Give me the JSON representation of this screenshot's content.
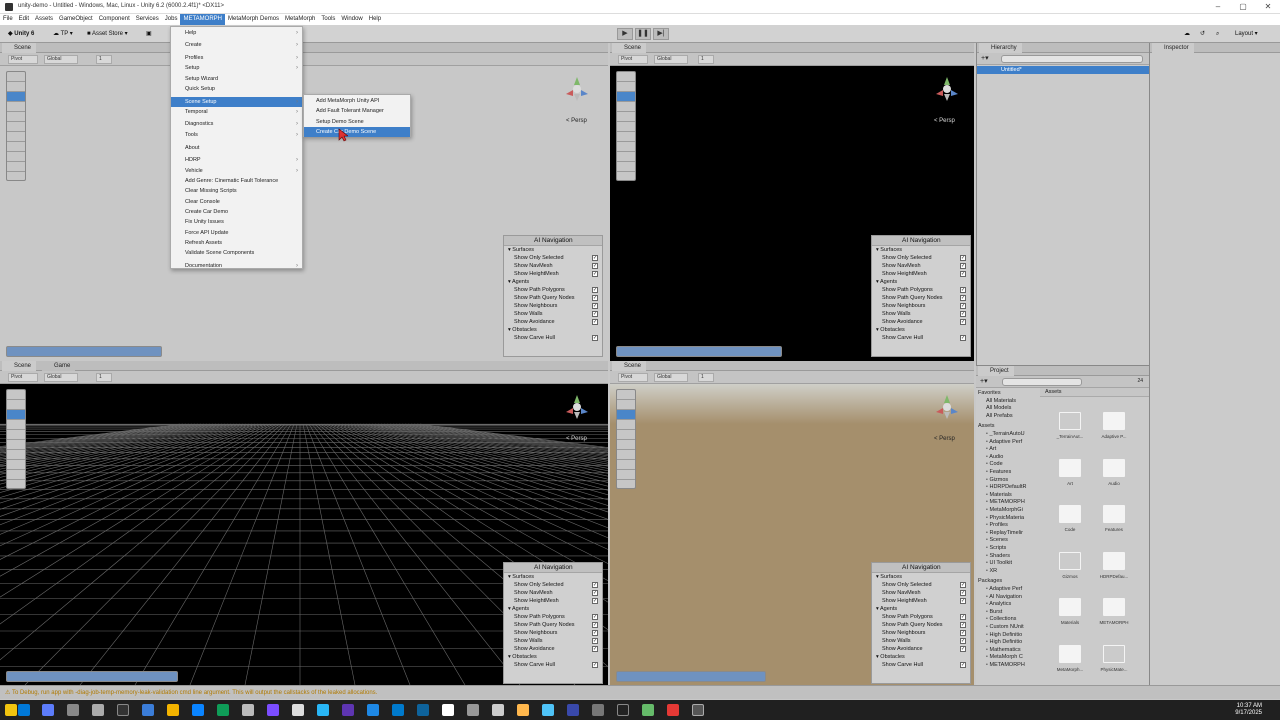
{
  "window": {
    "title": "unity-demo - Untitled - Windows, Mac, Linux - Unity 6.2 (6000.2.4f1)* <DX11>",
    "controls": [
      "–",
      "▢",
      "✕"
    ]
  },
  "menubar": [
    "File",
    "Edit",
    "Assets",
    "GameObject",
    "Component",
    "Services",
    "Jobs",
    "METAMORPH",
    "MetaMorph Demos",
    "MetaMorph",
    "Tools",
    "Window",
    "Help"
  ],
  "toolbar": {
    "unity_label": "Unity 6",
    "account_label": "TP",
    "asset_store_label": "Asset Store",
    "layout_label": "Layout"
  },
  "context_menu": {
    "items": [
      {
        "label": "Help",
        "submenu": true
      },
      {
        "label": "Create",
        "submenu": true
      },
      {
        "label": "Profiles",
        "submenu": true
      },
      {
        "label": "Setup",
        "submenu": true
      },
      {
        "label": "Setup Wizard",
        "submenu": false
      },
      {
        "label": "Quick Setup",
        "submenu": false
      },
      {
        "label": "Scene Setup",
        "submenu": true,
        "highlighted": true
      },
      {
        "label": "Temporal",
        "submenu": true
      },
      {
        "label": "Diagnostics",
        "submenu": true
      },
      {
        "label": "Tools",
        "submenu": true
      },
      {
        "label": "About",
        "submenu": false
      },
      {
        "label": "HDRP",
        "submenu": true
      },
      {
        "label": "Vehicle",
        "submenu": true
      },
      {
        "label": "Add Genre: Cinematic Fault Tolerance",
        "submenu": false
      },
      {
        "label": "Clear Missing Scripts",
        "submenu": false
      },
      {
        "label": "Clear Console",
        "submenu": false
      },
      {
        "label": "Create Car Demo",
        "submenu": false
      },
      {
        "label": "Fix Unity Issues",
        "submenu": false
      },
      {
        "label": "Force API Update",
        "submenu": false
      },
      {
        "label": "Refresh Assets",
        "submenu": false
      },
      {
        "label": "Validate Scene Components",
        "submenu": false
      },
      {
        "label": "Documentation",
        "submenu": true
      }
    ],
    "submenu_items": [
      {
        "label": "Add MetaMorph Unity API",
        "highlighted": false
      },
      {
        "label": "Add Fault Tolerant Manager",
        "highlighted": false
      },
      {
        "label": "Setup Demo Scene",
        "highlighted": false
      },
      {
        "label": "Create Car Demo Scene",
        "highlighted": true
      }
    ]
  },
  "scene_panes": [
    {
      "tab": "Scene",
      "tab2": "",
      "persp": "< Persp",
      "bg": "#c8c8c8"
    },
    {
      "tab": "Scene",
      "tab2": "",
      "persp": "< Persp",
      "bg": "#000000"
    },
    {
      "tab": "Scene",
      "tab2": "Game",
      "persp": "< Persp",
      "bg": "#000000"
    },
    {
      "tab": "Scene",
      "tab2": "",
      "persp": "< Persp",
      "bg": "#a58f6c"
    }
  ],
  "pane_toolbar": {
    "pivot": "Pivot",
    "global": "Global",
    "grid_value": "1"
  },
  "ai_navigation": {
    "title": "AI Navigation",
    "sections": [
      {
        "name": "Surfaces",
        "rows": [
          "Show Only Selected",
          "Show NavMesh",
          "Show HeightMesh"
        ]
      },
      {
        "name": "Agents",
        "rows": [
          "Show Path Polygons",
          "Show Path Query Nodes",
          "Show Neighbours",
          "Show Walls",
          "Show Avoidance"
        ]
      },
      {
        "name": "Obstacles",
        "rows": [
          "Show Carve Hull"
        ]
      }
    ]
  },
  "hierarchy": {
    "tab": "Hierarchy",
    "root": "Untitled*"
  },
  "inspector": {
    "tab": "Inspector"
  },
  "project": {
    "tab": "Project",
    "favorites_label": "Favorites",
    "favorites": [
      "All Materials",
      "All Models",
      "All Prefabs"
    ],
    "assets_label": "Assets",
    "asset_tree": [
      "_TerrainAutoU",
      "Adaptive Perf",
      "Art",
      "Audio",
      "Code",
      "Features",
      "Gizmos",
      "HDRPDefaultR",
      "Materials",
      "METAMORPH",
      "MetaMorphGi",
      "PhysicMateria",
      "Profiles",
      "ReplayTimelir",
      "Scenes",
      "Scripts",
      "Shaders",
      "UI Toolkit",
      "XR"
    ],
    "packages_label": "Packages",
    "package_tree": [
      "Adaptive Perf",
      "AI Navigation",
      "Analytics",
      "Burst",
      "Collections",
      "Custom NUnit",
      "High Definitio",
      "High Definitio",
      "Mathematics",
      "MetaMorph C",
      "METAMORPH"
    ],
    "grid_header": "Assets",
    "grid_items": [
      {
        "label": "_TerrainAut...",
        "outline": true
      },
      {
        "label": "Adaptive P...",
        "outline": false
      },
      {
        "label": "Art",
        "outline": false
      },
      {
        "label": "Audio",
        "outline": false
      },
      {
        "label": "Code",
        "outline": false
      },
      {
        "label": "Features",
        "outline": false
      },
      {
        "label": "Gizmos",
        "outline": true
      },
      {
        "label": "HDRPDefau...",
        "outline": false
      },
      {
        "label": "Materials",
        "outline": false
      },
      {
        "label": "METAMORPH",
        "outline": false
      },
      {
        "label": "MetaMorph...",
        "outline": false
      },
      {
        "label": "PhysicMate...",
        "outline": true
      }
    ],
    "count": "24"
  },
  "status": {
    "message": "To Debug, run app with -diag-job-temp-memory-leak-validation cmd line argument. This will output the callstacks of the leaked allocations."
  },
  "clock": {
    "time": "10:37 AM",
    "date": "9/17/2025"
  }
}
